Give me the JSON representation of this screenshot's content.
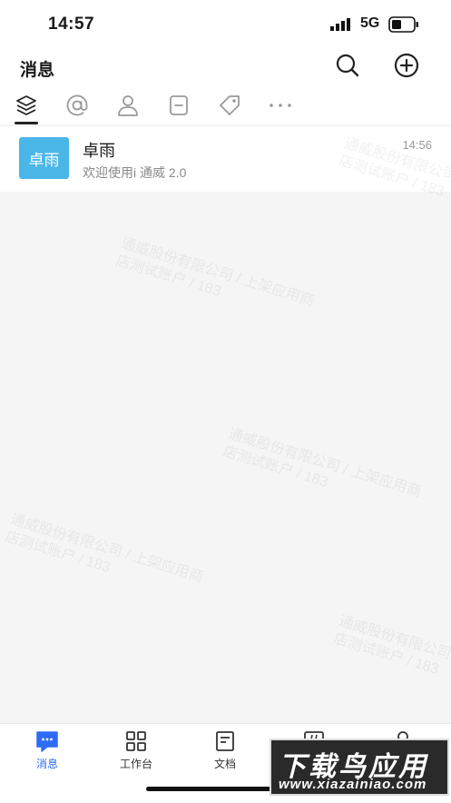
{
  "status": {
    "time": "14:57",
    "network": "5G"
  },
  "header": {
    "title": "消息"
  },
  "tabs": [
    {
      "icon": "layers-icon"
    },
    {
      "icon": "at-icon"
    },
    {
      "icon": "person-icon"
    },
    {
      "icon": "note-icon"
    },
    {
      "icon": "tag-icon"
    },
    {
      "icon": "more-icon"
    }
  ],
  "conversations": [
    {
      "avatar_text": "卓雨",
      "name": "卓雨",
      "preview": "欢迎使用i 通威 2.0",
      "time": "14:56",
      "avatar_color": "#4ab6e8"
    }
  ],
  "watermarks": [
    "通威股份有限公司 / 上架应用商",
    "店测试账户 / 183"
  ],
  "bottom_nav": [
    {
      "label": "消息",
      "icon": "message-icon",
      "active": true
    },
    {
      "label": "工作台",
      "icon": "grid-icon"
    },
    {
      "label": "文档",
      "icon": "document-icon"
    },
    {
      "label": "",
      "icon": "topic-icon"
    },
    {
      "label": "",
      "icon": "profile-icon"
    }
  ],
  "promo": {
    "title": "下载鸟应用",
    "url": "www.xiazainiao.com"
  },
  "colors": {
    "accent": "#2f6cf6",
    "avatar": "#4ab6e8",
    "background": "#f5f5f5"
  }
}
